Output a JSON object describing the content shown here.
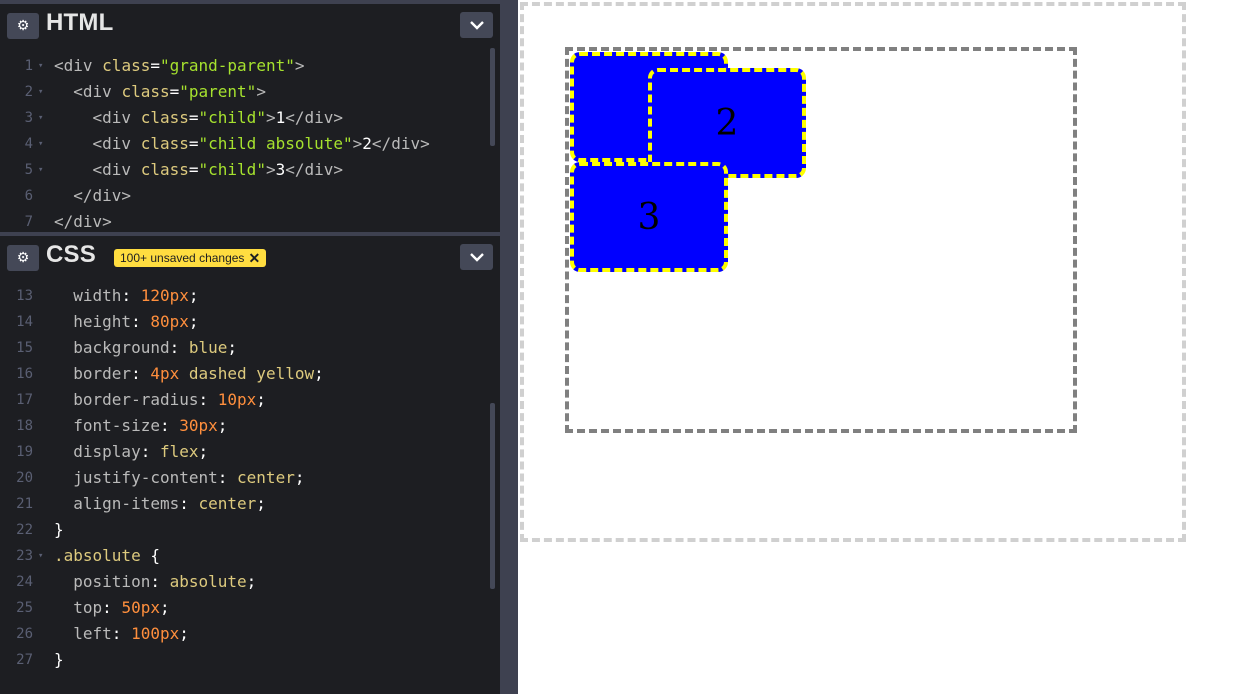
{
  "html_pane": {
    "title": "HTML",
    "lines": [
      {
        "n": "1",
        "fold": "▾",
        "parts": [
          [
            "tag",
            "<div "
          ],
          [
            "attr",
            "class"
          ],
          [
            "punc",
            "="
          ],
          [
            "str",
            "\"grand-parent\""
          ],
          [
            "tag",
            ">"
          ]
        ]
      },
      {
        "n": "2",
        "fold": "▾",
        "parts": [
          [
            "tag",
            "  <div "
          ],
          [
            "attr",
            "class"
          ],
          [
            "punc",
            "="
          ],
          [
            "str",
            "\"parent\""
          ],
          [
            "tag",
            ">"
          ]
        ]
      },
      {
        "n": "3",
        "fold": "▾",
        "parts": [
          [
            "tag",
            "    <div "
          ],
          [
            "attr",
            "class"
          ],
          [
            "punc",
            "="
          ],
          [
            "str",
            "\"child\""
          ],
          [
            "tag",
            ">"
          ],
          [
            "txt",
            "1"
          ],
          [
            "tag",
            "</div>"
          ]
        ]
      },
      {
        "n": "4",
        "fold": "▾",
        "parts": [
          [
            "tag",
            "    <div "
          ],
          [
            "attr",
            "class"
          ],
          [
            "punc",
            "="
          ],
          [
            "str",
            "\"child absolute\""
          ],
          [
            "tag",
            ">"
          ],
          [
            "txt",
            "2"
          ],
          [
            "tag",
            "</div>"
          ]
        ]
      },
      {
        "n": "5",
        "fold": "▾",
        "parts": [
          [
            "tag",
            "    <div "
          ],
          [
            "attr",
            "class"
          ],
          [
            "punc",
            "="
          ],
          [
            "str",
            "\"child\""
          ],
          [
            "tag",
            ">"
          ],
          [
            "txt",
            "3"
          ],
          [
            "tag",
            "</div>"
          ]
        ]
      },
      {
        "n": "6",
        "fold": "",
        "parts": [
          [
            "tag",
            "  </div>"
          ]
        ]
      },
      {
        "n": "7",
        "fold": "",
        "parts": [
          [
            "tag",
            "</div>"
          ]
        ]
      }
    ]
  },
  "css_pane": {
    "title": "CSS",
    "badge": "100+ unsaved changes",
    "badge_close": "✕",
    "lines": [
      {
        "n": "13",
        "fold": "",
        "parts": [
          [
            "prop",
            "  width"
          ],
          [
            "punc",
            ": "
          ],
          [
            "num",
            "120px"
          ],
          [
            "punc",
            ";"
          ]
        ]
      },
      {
        "n": "14",
        "fold": "",
        "parts": [
          [
            "prop",
            "  height"
          ],
          [
            "punc",
            ": "
          ],
          [
            "num",
            "80px"
          ],
          [
            "punc",
            ";"
          ]
        ]
      },
      {
        "n": "15",
        "fold": "",
        "parts": [
          [
            "prop",
            "  background"
          ],
          [
            "punc",
            ": "
          ],
          [
            "val",
            "blue"
          ],
          [
            "punc",
            ";"
          ]
        ]
      },
      {
        "n": "16",
        "fold": "",
        "parts": [
          [
            "prop",
            "  border"
          ],
          [
            "punc",
            ": "
          ],
          [
            "num",
            "4px"
          ],
          [
            "punc",
            " "
          ],
          [
            "val",
            "dashed yellow"
          ],
          [
            "punc",
            ";"
          ]
        ]
      },
      {
        "n": "17",
        "fold": "",
        "parts": [
          [
            "prop",
            "  border-radius"
          ],
          [
            "punc",
            ": "
          ],
          [
            "num",
            "10px"
          ],
          [
            "punc",
            ";"
          ]
        ]
      },
      {
        "n": "18",
        "fold": "",
        "parts": [
          [
            "prop",
            "  font-size"
          ],
          [
            "punc",
            ": "
          ],
          [
            "num",
            "30px"
          ],
          [
            "punc",
            ";"
          ]
        ]
      },
      {
        "n": "19",
        "fold": "",
        "parts": [
          [
            "prop",
            "  display"
          ],
          [
            "punc",
            ": "
          ],
          [
            "val",
            "flex"
          ],
          [
            "punc",
            ";"
          ]
        ]
      },
      {
        "n": "20",
        "fold": "",
        "parts": [
          [
            "prop",
            "  justify-content"
          ],
          [
            "punc",
            ": "
          ],
          [
            "val",
            "center"
          ],
          [
            "punc",
            ";"
          ]
        ]
      },
      {
        "n": "21",
        "fold": "",
        "parts": [
          [
            "prop",
            "  align-items"
          ],
          [
            "punc",
            ": "
          ],
          [
            "val",
            "center"
          ],
          [
            "punc",
            ";"
          ]
        ]
      },
      {
        "n": "22",
        "fold": "",
        "parts": [
          [
            "punc",
            "}"
          ]
        ]
      },
      {
        "n": "23",
        "fold": "▾",
        "parts": [
          [
            "sel",
            ".absolute"
          ],
          [
            "punc",
            " {"
          ]
        ]
      },
      {
        "n": "24",
        "fold": "",
        "parts": [
          [
            "prop",
            "  position"
          ],
          [
            "punc",
            ": "
          ],
          [
            "val",
            "absolute"
          ],
          [
            "punc",
            ";"
          ]
        ]
      },
      {
        "n": "25",
        "fold": "",
        "parts": [
          [
            "prop",
            "  top"
          ],
          [
            "punc",
            ": "
          ],
          [
            "num",
            "50px"
          ],
          [
            "punc",
            ";"
          ]
        ]
      },
      {
        "n": "26",
        "fold": "",
        "parts": [
          [
            "prop",
            "  left"
          ],
          [
            "punc",
            ": "
          ],
          [
            "num",
            "100px"
          ],
          [
            "punc",
            ";"
          ]
        ]
      },
      {
        "n": "27",
        "fold": "",
        "parts": [
          [
            "punc",
            "}"
          ]
        ]
      }
    ]
  },
  "preview": {
    "children": [
      "2",
      "3"
    ],
    "child_bg": "#0000ff",
    "child_border": "#ffff00"
  },
  "icons": {
    "gear": "⚙",
    "chevron": "chevron-down-icon"
  }
}
